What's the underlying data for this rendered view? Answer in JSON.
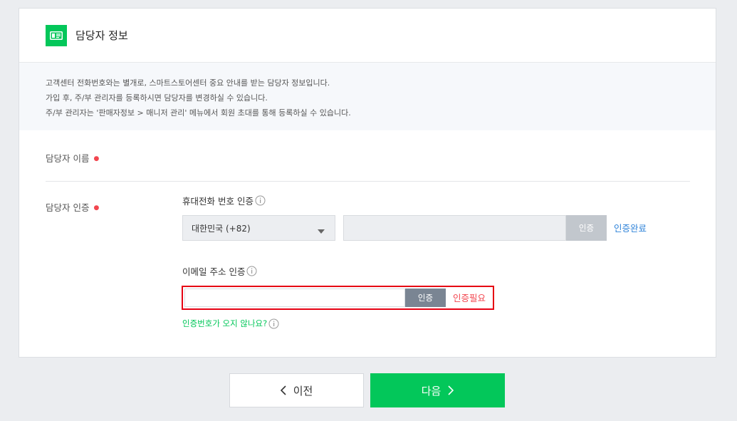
{
  "card": {
    "title": "담당자 정보",
    "icon": "id-card-icon"
  },
  "notice": {
    "lines": [
      "고객센터 전화번호와는 별개로, 스마트스토어센터 중요 안내를 받는 담당자 정보입니다.",
      "가입 후, 주/부 관리자를 등록하시면 담당자를 변경하실 수 있습니다.",
      "주/부 관리자는 '판매자정보 > 매니저 관리' 메뉴에서 회원 초대를 통해 등록하실 수 있습니다."
    ]
  },
  "fields": {
    "name_label": "담당자 이름",
    "auth_label": "담당자 인증",
    "required_mark": "●"
  },
  "phone": {
    "title": "휴대전화 번호 인증",
    "country_select": "대한민국 (+82)",
    "input_value": "",
    "verify_button": "인증",
    "status": "인증완료"
  },
  "email": {
    "title": "이메일 주소 인증",
    "input_value": "",
    "verify_button": "인증",
    "status": "인증필요",
    "no_code_link": "인증번호가 오지 않나요?"
  },
  "nav": {
    "prev": "이전",
    "next": "다음"
  },
  "colors": {
    "accent": "#03c75a",
    "error": "#f2464f",
    "done": "#2f83d9",
    "highlight_border": "#e60012"
  }
}
